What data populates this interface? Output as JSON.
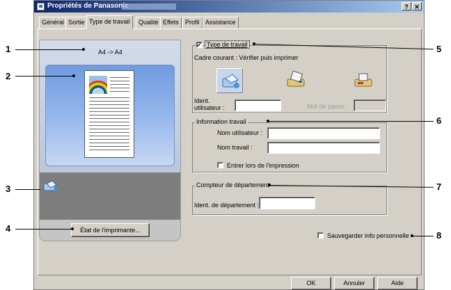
{
  "window": {
    "title": "Propriétés de Panasonic",
    "help_button": "?",
    "close_button": "✕"
  },
  "tabs": [
    {
      "label": "Général"
    },
    {
      "label": "Sortie"
    },
    {
      "label": "Type de travail"
    },
    {
      "label": "Qualité"
    },
    {
      "label": "Effets"
    },
    {
      "label": "Profil"
    },
    {
      "label": "Assistance"
    }
  ],
  "selected_tab": "Type de travail",
  "preview": {
    "paper_size_text": "A4 -> A4",
    "printer_status_button": "État de l'imprimante..."
  },
  "job_type": {
    "checkbox_label": "Type de travail",
    "checked": true,
    "current_frame_text": "Cadre courant : Vérifier puis imprimer",
    "icons": [
      "verify-print-icon",
      "secure-print-icon",
      "store-print-icon"
    ],
    "user_id_label_1": "Ident.",
    "user_id_label_2": "utilisateur :",
    "user_id_value": "",
    "password_label": "Mot de passe :",
    "password_value": ""
  },
  "job_info": {
    "group_label": "Information travail",
    "user_name_label": "Nom utilisateur :",
    "user_name_value": "",
    "job_name_label": "Nom travail :",
    "job_name_value": "",
    "enter_on_print_label": "Entrer lors de l'impression",
    "enter_on_print_checked": false
  },
  "department": {
    "group_label": "Compteur de département",
    "dept_id_label": "Ident. de département :",
    "dept_id_value": ""
  },
  "save_personal": {
    "label": "Sauvegarder info personnelle",
    "checked": false
  },
  "footer": {
    "ok": "OK",
    "cancel": "Annuler",
    "help": "Aide"
  },
  "callouts": [
    "1",
    "2",
    "3",
    "4",
    "5",
    "6",
    "7",
    "8"
  ]
}
